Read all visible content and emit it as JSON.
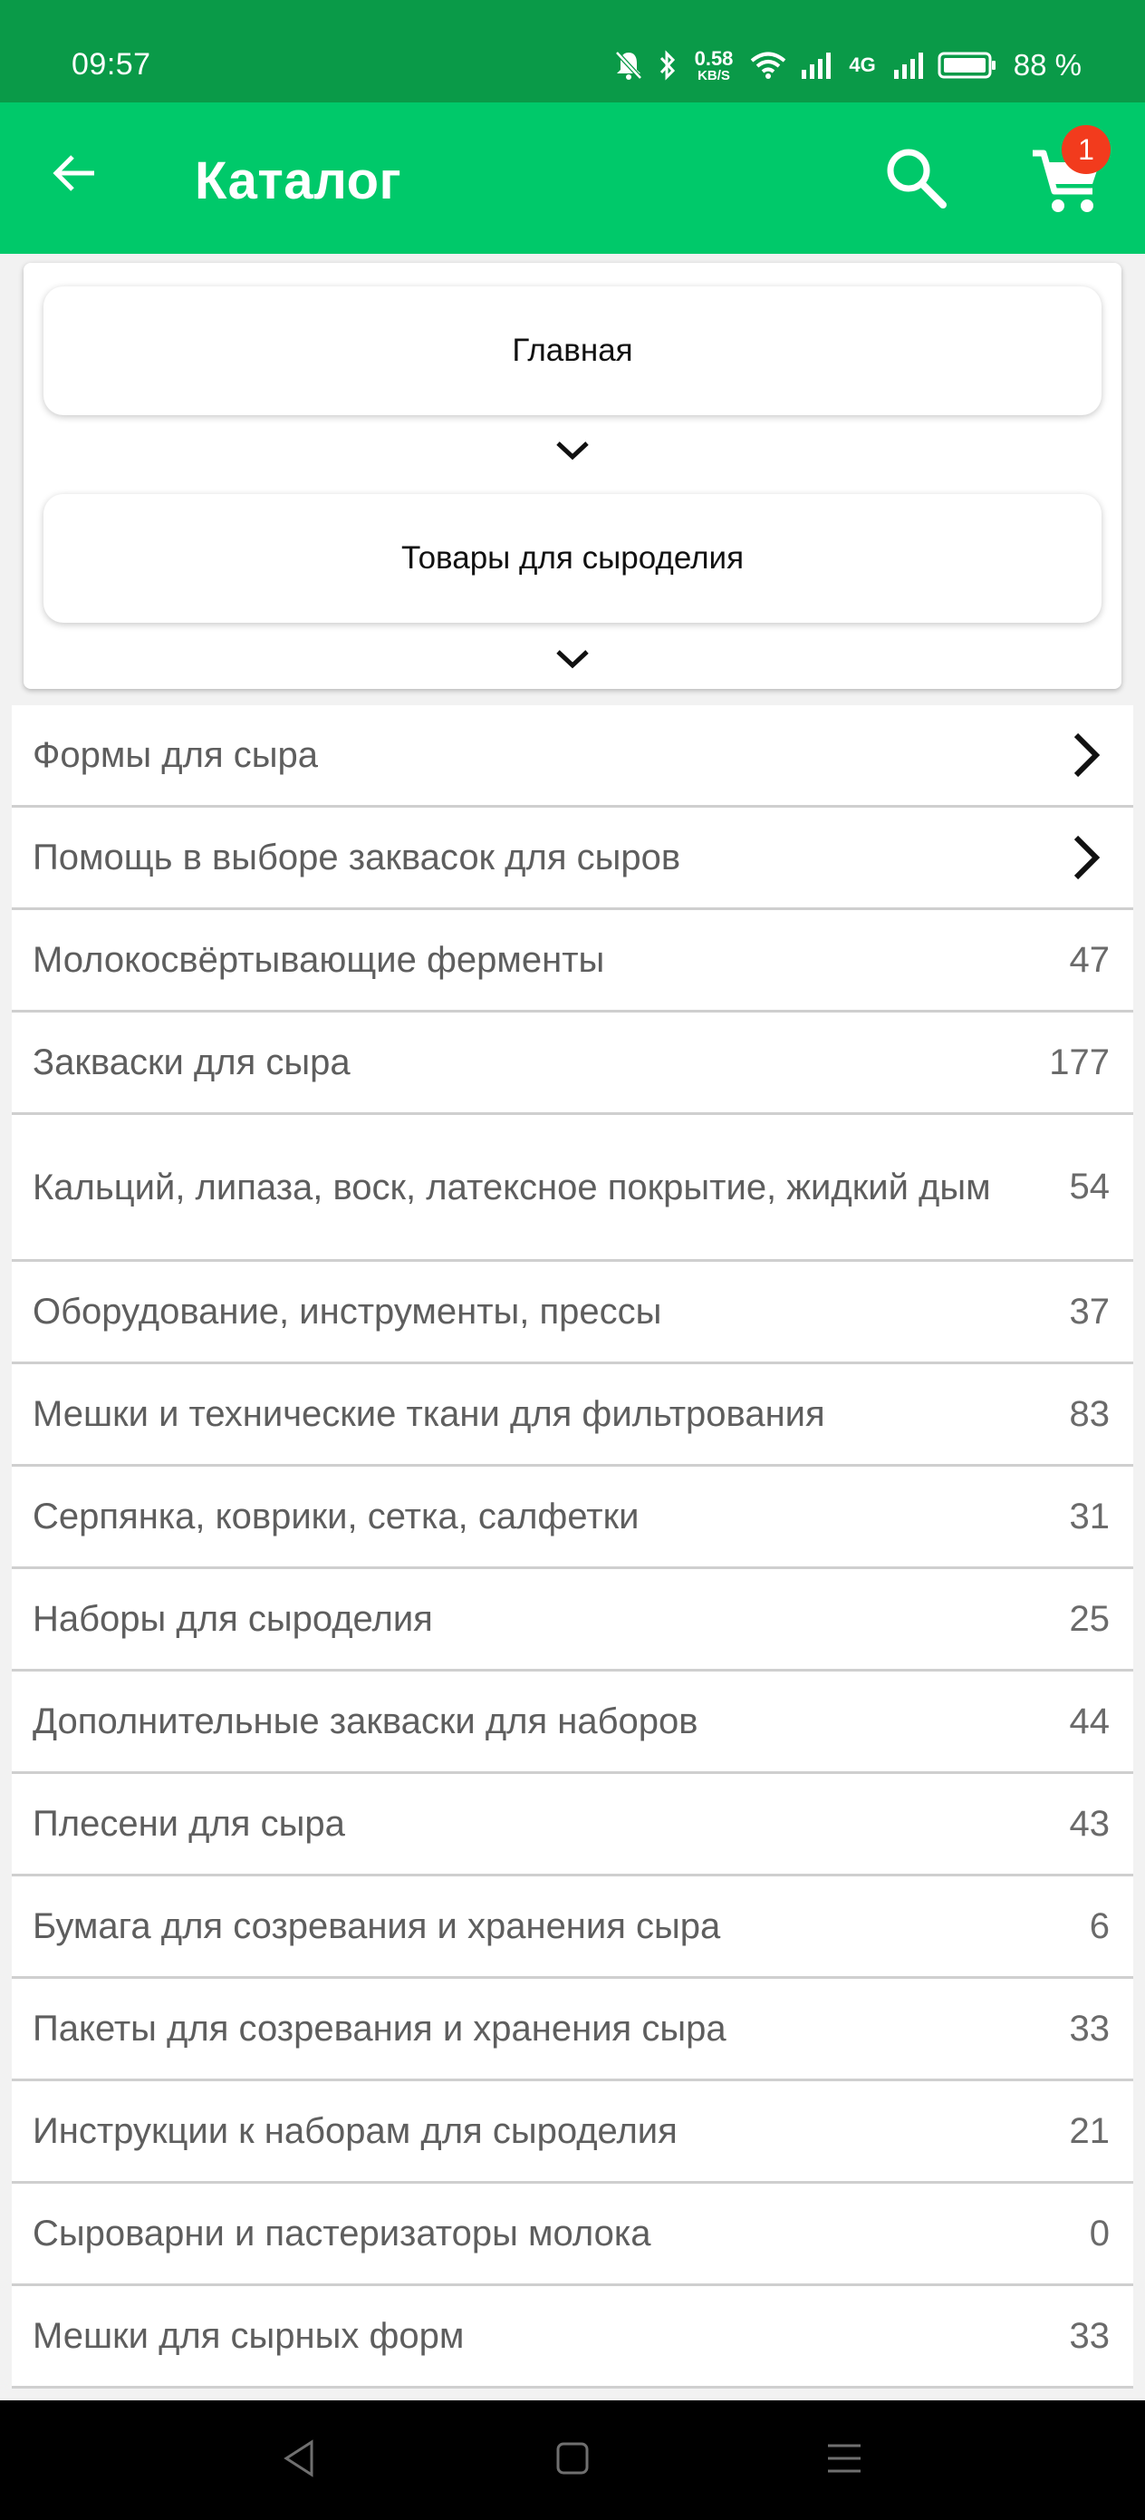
{
  "status_bar": {
    "time": "09:57",
    "net_speed_value": "0.58",
    "net_speed_unit": "KB/S",
    "signal_label": "4G",
    "battery_percent": "88 %",
    "icons": [
      "mute-icon",
      "bluetooth-icon",
      "wifi-icon",
      "signal-icon",
      "battery-icon"
    ]
  },
  "app_bar": {
    "title": "Каталог",
    "back_icon": "arrow-left-icon",
    "search_icon": "search-icon",
    "cart_icon": "cart-icon",
    "cart_badge": "1",
    "colors": {
      "status_bar": "#0a9a48",
      "app_bar": "#00c96a",
      "badge": "#f23b1d"
    }
  },
  "breadcrumb": {
    "home": "Главная",
    "current": "Товары для сыроделия",
    "chevron_icon": "chevron-down-icon"
  },
  "categories": [
    {
      "label": "Формы для сыра",
      "count": "",
      "has_children": true
    },
    {
      "label": "Помощь в выборе заквасок для сыров",
      "count": "",
      "has_children": true
    },
    {
      "label": "Молокосвёртывающие ферменты",
      "count": "47",
      "has_children": false
    },
    {
      "label": "Закваски для сыра",
      "count": "177",
      "has_children": false
    },
    {
      "label": "Кальций, липаза, воск, латексное покрытие, жидкий дым",
      "count": "54",
      "has_children": false
    },
    {
      "label": "Оборудование, инструменты, прессы",
      "count": "37",
      "has_children": false
    },
    {
      "label": "Мешки и технические ткани для фильтрования",
      "count": "83",
      "has_children": false
    },
    {
      "label": "Серпянка, коврики, сетка, салфетки",
      "count": "31",
      "has_children": false
    },
    {
      "label": "Наборы для сыроделия",
      "count": "25",
      "has_children": false
    },
    {
      "label": "Дополнительные закваски для наборов",
      "count": "44",
      "has_children": false
    },
    {
      "label": "Плесени для сыра",
      "count": "43",
      "has_children": false
    },
    {
      "label": "Бумага для созревания и хранения сыра",
      "count": "6",
      "has_children": false
    },
    {
      "label": "Пакеты для созревания и хранения сыра",
      "count": "33",
      "has_children": false
    },
    {
      "label": "Инструкции к наборам для сыроделия",
      "count": "21",
      "has_children": false
    },
    {
      "label": "Сыроварни и пастеризаторы молока",
      "count": "0",
      "has_children": false
    },
    {
      "label": "Мешки для сырных форм",
      "count": "33",
      "has_children": false
    }
  ],
  "nav_bar": {
    "icons": [
      "nav-back-icon",
      "nav-home-icon",
      "nav-menu-icon"
    ]
  }
}
